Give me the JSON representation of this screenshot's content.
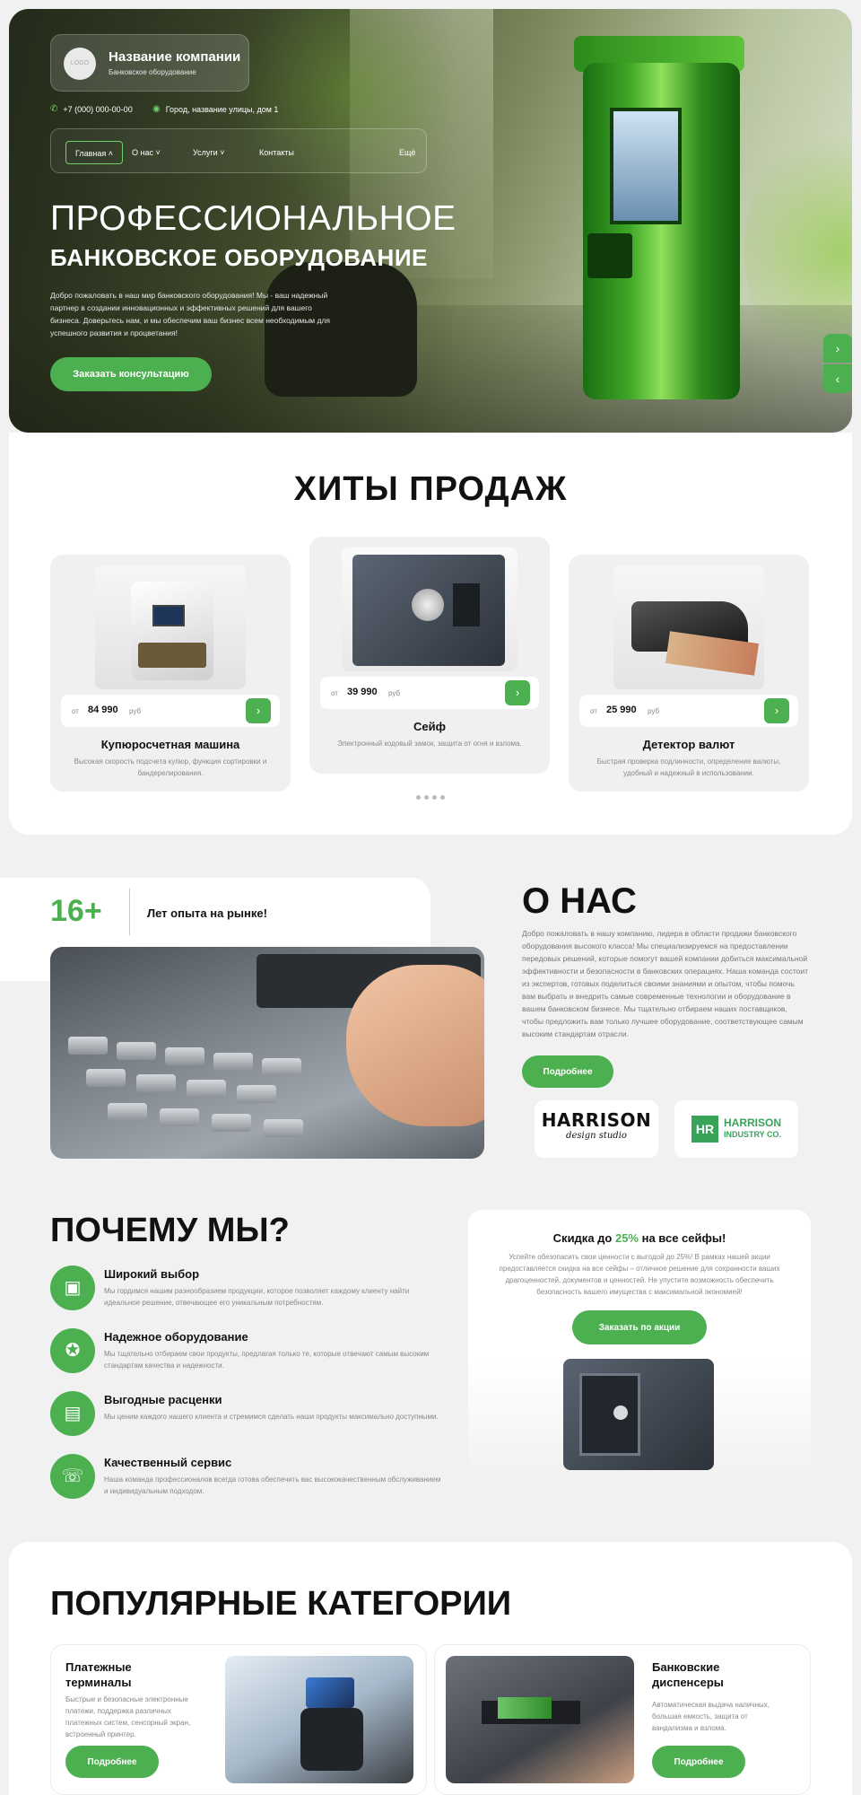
{
  "company": {
    "logo_text": "LOGO",
    "name": "Название компании",
    "subtitle": "Банковское оборудование"
  },
  "contacts": {
    "phone": "+7 (000) 000-00-00",
    "address": "Город, название улицы, дом 1"
  },
  "nav": {
    "items": [
      "Главная",
      "О нас",
      "Услуги",
      "Контакты"
    ],
    "more": "Ещё",
    "active": "Главная"
  },
  "hero": {
    "title_line1": "ПРОФЕССИОНАЛЬНОЕ",
    "title_line2": "БАНКОВСКОЕ ОБОРУДОВАНИЕ",
    "description": "Добро пожаловать в наш мир банковского оборудования! Мы - ваш надежный партнер в создании инновационных и эффективных решений для вашего бизнеса. Доверьтесь нам, и мы обеспечим ваш бизнес всем необходимым для успешного развития и процветания!",
    "cta": "Заказать консультацию",
    "arrow_next": "›",
    "arrow_prev": "‹"
  },
  "hits": {
    "title": "ХИТЫ ПРОДАЖ",
    "price_from": "от",
    "currency": "руб",
    "products": [
      {
        "name": "Купюросчетная машина",
        "price": "84 990",
        "desc": "Высокая скорость подсчета купюр, функция сортировки и бандерелирования."
      },
      {
        "name": "Сейф",
        "price": "39 990",
        "desc": "Электронный кодовый замок, защита от огня и взлома."
      },
      {
        "name": "Детектор валют",
        "price": "25 990",
        "desc": "Быстрая проверка подлинности, определение валюты, удобный и надежный в использовании."
      }
    ]
  },
  "about": {
    "exp_number": "16+",
    "exp_label": "Лет опыта на рынке!",
    "title": "О НАС",
    "text": "Добро пожаловать в нашу компанию, лидера в области продажи банковского оборудования высокого класса! Мы специализируемся на предоставлении передовых решений, которые помогут вашей компании добиться максимальной эффективности и безопасности в банковских операциях. Наша команда состоит из экспертов, готовых поделиться своими знаниями и опытом, чтобы помочь вам выбрать и внедрить самые современные технологии и оборудование в вашем банковском бизнесе. Мы тщательно отбираем наших поставщиков, чтобы предложить вам только лучшее оборудование, соответствующее самым высоким стандартам отрасли.",
    "button": "Подробнее",
    "brand1": {
      "line1": "HARRISON",
      "line2": "design studio"
    },
    "brand2": {
      "mark": "HR",
      "line1": "HARRISON",
      "line2": "INDUSTRY CO."
    }
  },
  "why": {
    "title": "ПОЧЕМУ МЫ?",
    "items": [
      {
        "title": "Широкий выбор",
        "text": "Мы гордимся нашим разнообразием продукции, которое позволяет каждому клиенту найти идеальное решение, отвечающее его уникальным потребностям.",
        "icon": "safe-icon"
      },
      {
        "title": "Надежное оборудование",
        "text": "Мы тщательно отбираем свои продукты, предлагая только те, которые отвечают самым высоким стандартам качества и надежности.",
        "icon": "award-icon"
      },
      {
        "title": "Выгодные расценки",
        "text": "Мы ценим каждого нашего клиента и стремимся сделать наши продукты максимально доступными.",
        "icon": "wallet-icon"
      },
      {
        "title": "Качественный сервис",
        "text": "Наша команда профессионалов всегда готова обеспечить вас высококачественным обслуживанием и индивидуальным подходом.",
        "icon": "support-icon"
      }
    ]
  },
  "promo": {
    "title_before": "Скидка до ",
    "title_pct": "25%",
    "title_after": " на все сейфы!",
    "text": "Успейте обезопасить свои ценности с выгодой до 25%! В рамках нашей акции предоставляется скидка на все сейфы – отличное решение для сохранности ваших драгоценностей, документов и ценностей. Не упустите возможность обеспечить безопасность вашего имущества с максимальной экономией!",
    "button": "Заказать по акции"
  },
  "categories": {
    "title": "ПОПУЛЯРНЫЕ КАТЕГОРИИ",
    "items": [
      {
        "title": "Платежные терминалы",
        "text": "Быстрые и безопасные электронные платежи, поддержка различных платежных систем, сенсорный экран, встроенный принтер.",
        "button": "Подробнее"
      },
      {
        "title": "Банковские диспенсеры",
        "text": "Автоматическая выдача наличных, большая емкость, защита от вандализма и взлома.",
        "button": "Подробнее"
      }
    ]
  },
  "colors": {
    "accent": "#4caf50",
    "background": "#f1f1f1"
  }
}
